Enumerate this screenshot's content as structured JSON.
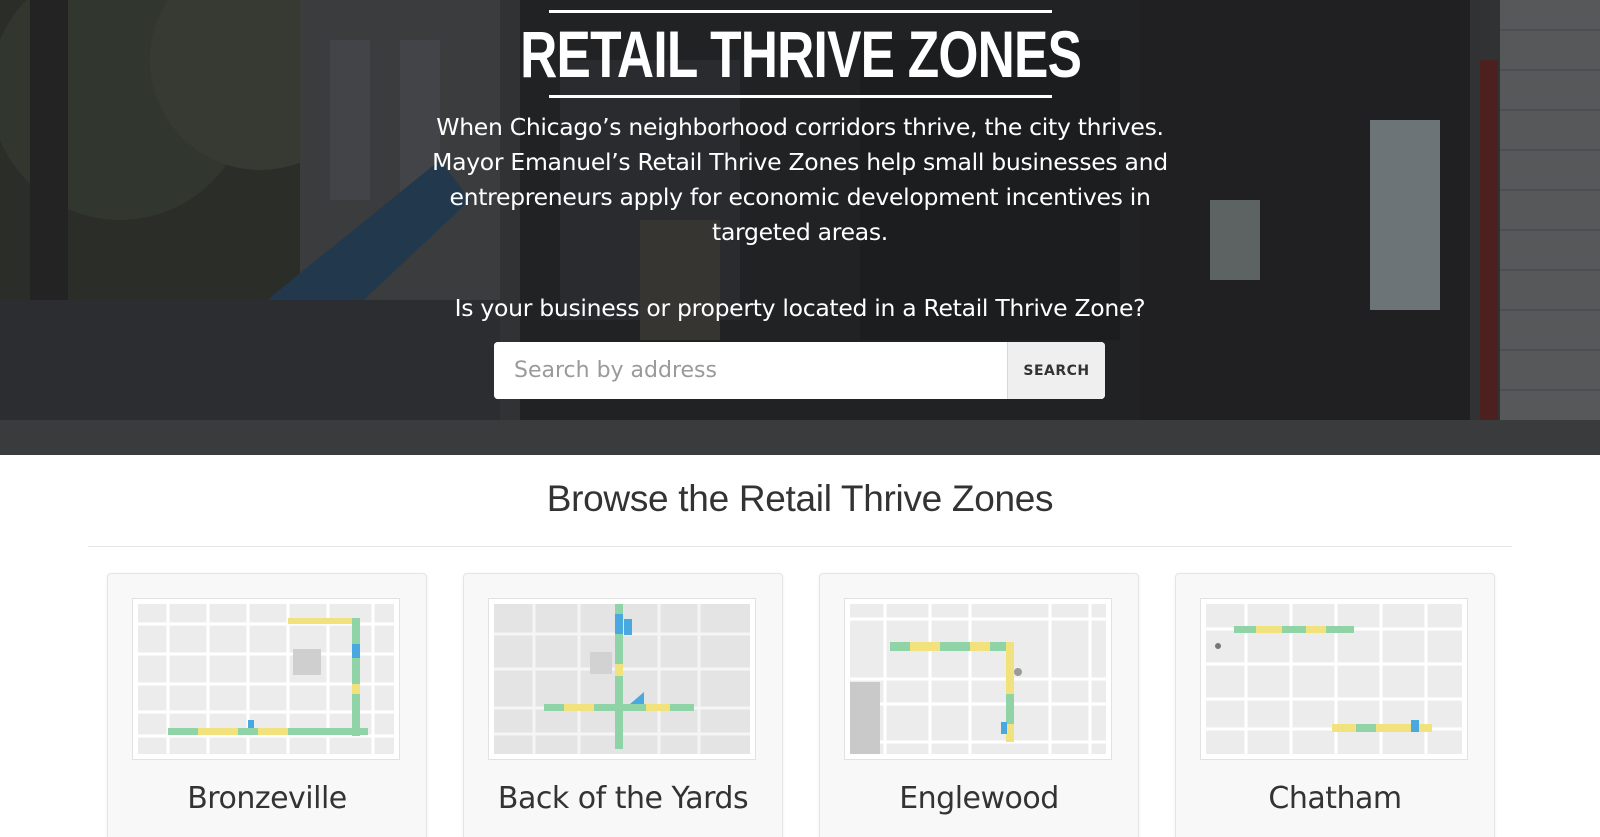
{
  "hero": {
    "title": "RETAIL THRIVE ZONES",
    "intro": "When Chicago’s neighborhood corridors thrive, the city thrives. Mayor Emanuel’s Retail Thrive Zones help small businesses and entrepreneurs apply for economic development incentives in targeted areas.",
    "question": "Is your business or property located in a Retail Thrive Zone?"
  },
  "search": {
    "placeholder": "Search by address",
    "button_label": "SEARCH"
  },
  "browse": {
    "title": "Browse the Retail Thrive Zones",
    "zones": [
      {
        "name": "Bronzeville"
      },
      {
        "name": "Back of the Yards"
      },
      {
        "name": "Englewood"
      },
      {
        "name": "Chatham"
      }
    ]
  },
  "colors": {
    "zone_green": "#8fd3a7",
    "zone_yellow": "#f2e27d",
    "zone_blue": "#49a8e0",
    "map_road": "#ffffff",
    "map_base": "#ececec"
  }
}
